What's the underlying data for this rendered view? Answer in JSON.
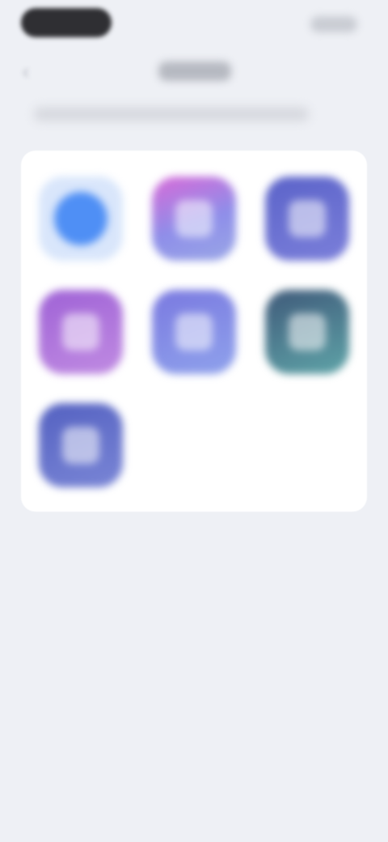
{
  "status_bar": {
    "time": "",
    "right_icons": ""
  },
  "nav": {
    "back_icon": "chevron-left-icon",
    "title": ""
  },
  "subtitle": "",
  "apps": [
    {
      "name": "",
      "icon": "app-icon",
      "color": "#4f8ff5"
    },
    {
      "name": "",
      "icon": "app-icon",
      "color": "#d86ad8"
    },
    {
      "name": "",
      "icon": "app-icon",
      "color": "#5b63c9"
    },
    {
      "name": "",
      "icon": "app-icon",
      "color": "#9f62d6"
    },
    {
      "name": "",
      "icon": "app-icon",
      "color": "#7a79e0"
    },
    {
      "name": "",
      "icon": "app-icon",
      "color": "#3f5a7a"
    },
    {
      "name": "",
      "icon": "app-icon",
      "color": "#5461c1"
    }
  ],
  "colors": {
    "background": "#eef0f5",
    "card": "#ffffff"
  }
}
